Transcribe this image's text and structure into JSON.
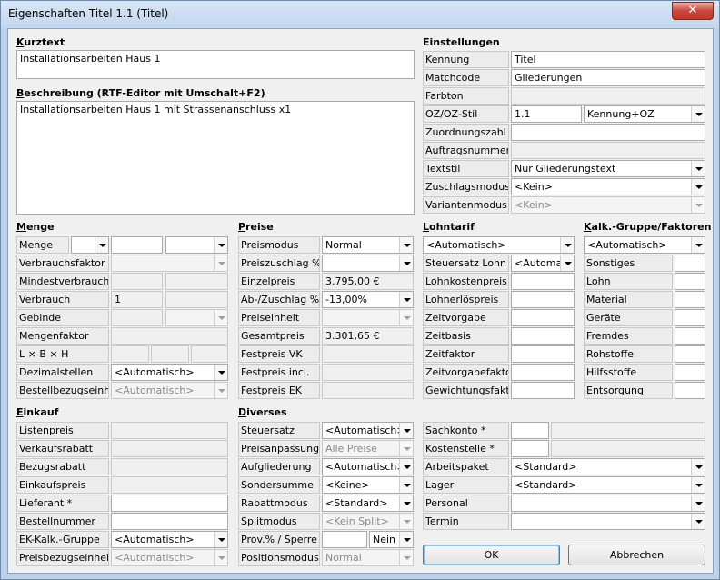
{
  "window": {
    "title": "Eigenschaften Titel 1.1 (Titel)",
    "close": "✕"
  },
  "kurztext": {
    "heading_u": "K",
    "heading_rest": "urztext",
    "value": "Installationsarbeiten Haus 1"
  },
  "beschreibung": {
    "heading_u": "B",
    "heading_rest": "eschreibung (RTF-Editor mit Umschalt+F2)",
    "value": "Installationsarbeiten Haus 1 mit Strassenanschluss x1"
  },
  "einstellungen": {
    "heading": "Einstellungen",
    "kennung_label": "Kennung",
    "kennung": "Titel",
    "matchcode_label": "Matchcode",
    "matchcode": "Gliederungen",
    "farbton_label": "Farbton",
    "ozstil_label": "OZ/OZ-Stil",
    "oz": "1.1",
    "ozstil": "Kennung+OZ",
    "zuordnung_label": "Zuordnungszahl",
    "auftrag_label": "Auftragsnummer",
    "textstil_label": "Textstil",
    "textstil": "Nur Gliederungstext",
    "zuschlag_label": "Zuschlagsmodus",
    "zuschlag": "<Kein>",
    "variante_label": "Variantenmodus",
    "variante": "<Kein>"
  },
  "menge": {
    "heading_u": "M",
    "heading_rest": "enge",
    "menge_label": "Menge",
    "verbrauchsfaktor": "Verbrauchsfaktor",
    "mindestverbrauch": "Mindestverbrauch",
    "verbrauch_label": "Verbrauch",
    "verbrauch": "1",
    "gebinde": "Gebinde",
    "mengenfaktor": "Mengenfaktor",
    "lbh": "L × B × H",
    "dezimal_label": "Dezimalstellen",
    "dezimal": "<Automatisch>",
    "bestell_label": "Bestellbezugseinheit",
    "bestell": "<Automatisch>"
  },
  "preise": {
    "heading_u": "P",
    "heading_rest": "reise",
    "modus_label": "Preismodus",
    "modus": "Normal",
    "zuschlag_label": "Preiszuschlag %",
    "einzel_label": "Einzelpreis",
    "einzel": "3.795,00 €",
    "abzu_label": "Ab-/Zuschlag %",
    "abzu": "-13,00%",
    "einheit_label": "Preiseinheit",
    "gesamt_label": "Gesamtpreis",
    "gesamt": "3.301,65 €",
    "festvk": "Festpreis VK",
    "festincl": "Festpreis incl.",
    "festek": "Festpreis EK"
  },
  "lohn": {
    "heading_u": "L",
    "heading_rest": "ohntarif",
    "tarif": "<Automatisch>",
    "steuersatz_label": "Steuersatz Lohn",
    "steuersatz": "<Automat",
    "rows": [
      "Lohnkostenpreis",
      "Lohnerlöspreis",
      "Zeitvorgabe",
      "Zeitbasis",
      "Zeitfaktor",
      "Zeitvorgabefaktor",
      "Gewichtungsfaktor"
    ]
  },
  "kalk": {
    "heading_u": "K",
    "heading_rest": "alk.-Gruppe/Faktoren",
    "gruppe": "<Automatisch>",
    "rows": [
      "Sonstiges",
      "Lohn",
      "Material",
      "Geräte",
      "Fremdes",
      "Rohstoffe",
      "Hilfsstoffe",
      "Entsorgung"
    ]
  },
  "einkauf": {
    "heading_u": "E",
    "heading_rest": "inkauf",
    "rows": [
      "Listenpreis",
      "Verkaufsrabatt",
      "Bezugsrabatt",
      "Einkaufspreis",
      "Lieferant *",
      "Bestellnummer"
    ],
    "ekgruppe_label": "EK-Kalk.-Gruppe",
    "ekgruppe": "<Automatisch>",
    "preisbezug_label": "Preisbezugseinheit",
    "preisbezug": "<Automatisch>"
  },
  "diverses": {
    "heading_u": "D",
    "heading_rest": "iverses",
    "steuer_label": "Steuersatz",
    "steuer": "<Automatisch>",
    "anpassung_label": "Preisanpassung",
    "anpassung": "Alle Preise",
    "aufgl_label": "Aufgliederung",
    "aufgl": "<Automatisch>",
    "sonder_label": "Sondersumme",
    "sonder": "<Keine>",
    "rabatt_label": "Rabattmodus",
    "rabatt": "<Standard>",
    "split_label": "Splitmodus",
    "split": "<Kein Split>",
    "prov_label": "Prov.% / Sperre",
    "sperre": "Nein",
    "pos_label": "Positionsmodus",
    "pos": "Normal"
  },
  "konten": {
    "sachkonto": "Sachkonto *",
    "kostenstelle": "Kostenstelle *",
    "arbeitspaket_label": "Arbeitspaket",
    "arbeitspaket": "<Standard>",
    "lager_label": "Lager",
    "lager": "<Standard>",
    "personal": "Personal",
    "termin": "Termin"
  },
  "buttons": {
    "ok": "OK",
    "cancel": "Abbrechen"
  }
}
